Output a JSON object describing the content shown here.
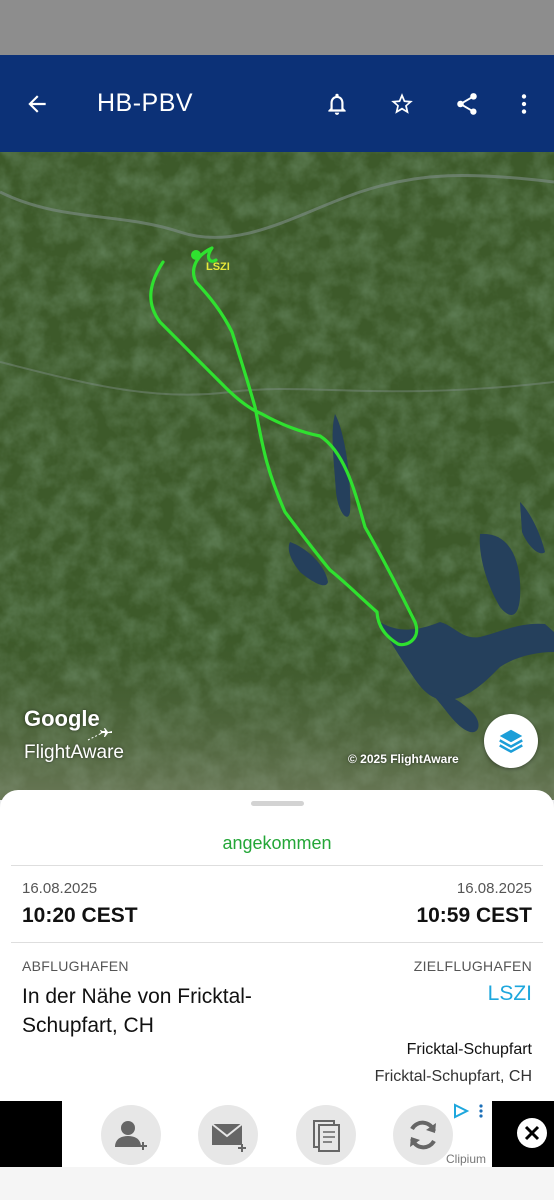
{
  "app_bar": {
    "title": "HB-PBV",
    "back_icon": "arrow-left-icon",
    "actions": [
      "bell-icon",
      "star-icon",
      "share-icon",
      "more-vertical-icon"
    ]
  },
  "map": {
    "airport_marker": "LSZI",
    "google_logo": "Google",
    "flightaware_logo": "FlightAware",
    "copyright": "© 2025 FlightAware",
    "track_color": "#2fe12f",
    "layers_icon": "layers-icon"
  },
  "flight": {
    "status": "angekommen",
    "status_color": "#23a637",
    "departure_date": "16.08.2025",
    "departure_time": "10:20 CEST",
    "arrival_date": "16.08.2025",
    "arrival_time": "10:59 CEST",
    "origin_label": "ABFLUGHAFEN",
    "origin_name": "In der Nähe von Fricktal-Schupfart, CH",
    "destination_label": "ZIELFLUGHAFEN",
    "destination_code": "LSZI",
    "destination_name": "Fricktal-Schupfart",
    "destination_location": "Fricktal-Schupfart, CH"
  },
  "ad": {
    "brand": "Clipium",
    "icons": [
      "add-user-icon",
      "add-mail-icon",
      "documents-icon",
      "refresh-icon"
    ],
    "close_icon": "close-icon"
  }
}
